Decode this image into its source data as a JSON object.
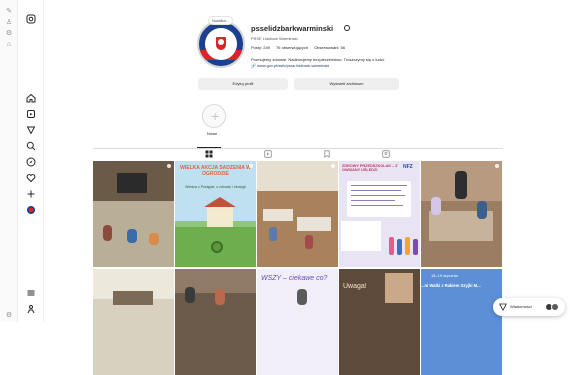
{
  "profile": {
    "username": "psselidzbarkwarminski",
    "subname": "PSSE Lidzbark Warmiński",
    "note": "Notatka...",
    "stats": {
      "posts": "Posty: 249",
      "followers": "76 obserwujących",
      "following": "Obserwowani: 56"
    },
    "bio": "Promujemy zdrowie. Nadzorujemy bezpieczeństwo. Troszczymy się o ludzi.",
    "link": "www.gov.pl/web/psse-lidzbark-warminski",
    "edit_button": "Edytuj profil",
    "archive_button": "Wyświetl archiwum"
  },
  "highlights": [
    {
      "label": "Nowe"
    }
  ],
  "tiles": {
    "tile2_title": "WIELKA AKCJA SADZENIA W OGRODZIE",
    "tile2_sub": "Wiedza o Postępie, o zdrowiu i ekologii",
    "tile4_title": "ZDROWY PRZEDSZKOLAK – Z OWSIANY UŚLEDZI",
    "tile4_badge": "NFZ",
    "tile8_text": "WSZY – ciekawe co?",
    "tile9_text": "Uwaga!",
    "tile10_date": "18–19 stycznia",
    "tile10_text": "...ni Walki z Rakiem Szyjki M..."
  },
  "messages": {
    "label": "Wiadomości"
  }
}
